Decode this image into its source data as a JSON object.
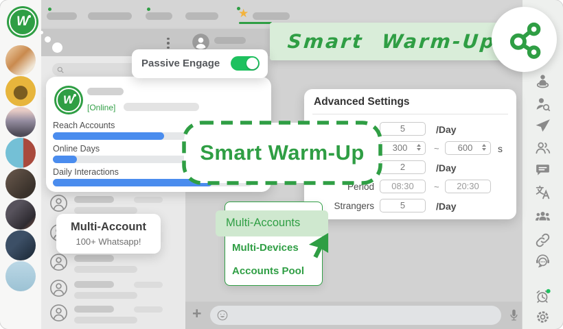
{
  "colors": {
    "green": "#2f9e44",
    "toggle-green": "#1ec15f",
    "blue": "#4a8cee",
    "banner-bg": "#d9edd9",
    "hl-green": "#cfe8cf",
    "gold": "#f3b33d"
  },
  "header_banner": {
    "title": "Smart Warm-Up"
  },
  "top_bar": {
    "star": "★"
  },
  "passive_card": {
    "label": "Passive Engage",
    "toggle_state": "on"
  },
  "account_card": {
    "status": "[Online]",
    "metrics": [
      {
        "label": "Reach Accounts",
        "pct": 56
      },
      {
        "label": "Online Days",
        "pct": 12
      },
      {
        "label": "Daily Interactions",
        "pct": 80
      }
    ]
  },
  "stamp": {
    "title": "Smart Warm-Up"
  },
  "advanced": {
    "title": "Advanced Settings",
    "rows": [
      {
        "value": "5",
        "suffix": "/Day"
      },
      {
        "min": "300",
        "tilde": "~",
        "max": "600",
        "suffix": "s"
      },
      {
        "value": "2",
        "suffix": "/Day"
      },
      {
        "label": "Period",
        "from": "08:30",
        "tilde": "~",
        "to": "20:30"
      },
      {
        "label": "Strangers",
        "value": "5",
        "suffix": "/Day"
      }
    ]
  },
  "multi_account_card": {
    "title": "Multi-Account",
    "subtitle": "100+ Whatsapp!"
  },
  "dropdown": {
    "items": [
      {
        "label": "Multi-Accounts",
        "active": true
      },
      {
        "label": "Multi-Devices",
        "active": false
      },
      {
        "label": "Accounts Pool",
        "active": false
      }
    ]
  },
  "logo": {
    "letter": "W"
  },
  "input_bar": {
    "plus": "+"
  },
  "icons": {
    "right_rail": [
      "user-status-icon",
      "user-search-icon",
      "send-icon",
      "contacts-icon",
      "chat-icon",
      "translate-icon",
      "group-icon",
      "link-icon",
      "support-icon",
      "alarm-icon",
      "settings-icon"
    ]
  }
}
